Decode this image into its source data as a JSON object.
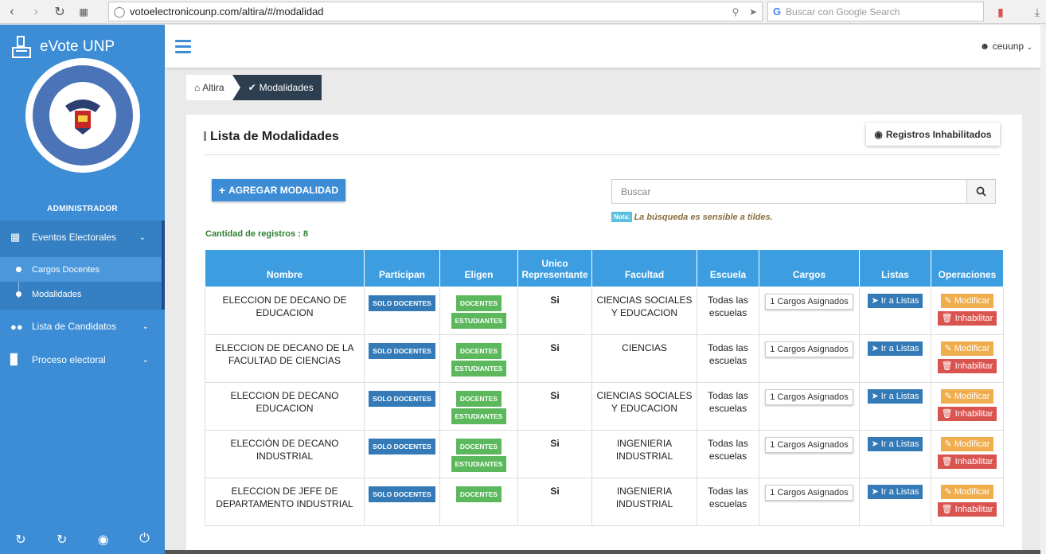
{
  "browser": {
    "url": "votoelectronicounp.com/altira/#/modalidad",
    "search_placeholder": "Buscar con Google Search"
  },
  "sidebar": {
    "brand": "eVote UNP",
    "role": "ADMINISTRADOR",
    "menu": [
      {
        "label": "Eventos Electorales",
        "icon": "calendar-icon"
      },
      {
        "label": "Lista de Candidatos",
        "icon": "users-icon"
      },
      {
        "label": "Proceso electoral",
        "icon": "chart-icon"
      }
    ],
    "submenu": [
      {
        "label": "Cargos Docentes"
      },
      {
        "label": "Modalidades"
      }
    ]
  },
  "header": {
    "user": "ceuunp"
  },
  "breadcrumb": {
    "home": "Altira",
    "current": "Modalidades"
  },
  "page": {
    "title": "Lista de Modalidades",
    "inhabilitados_label": "Registros Inhabilitados",
    "add_label": "AGREGAR MODALIDAD",
    "search_placeholder": "Buscar",
    "nota_label": "Nota:",
    "nota_text": "La búsqueda es sensible a tildes.",
    "count_text": "Cantidad de registros : 8"
  },
  "table": {
    "headers": [
      "Nombre",
      "Participan",
      "Eligen",
      "Unico Representante",
      "Facultad",
      "Escuela",
      "Cargos",
      "Listas",
      "Operaciones"
    ],
    "rows": [
      {
        "nombre": "ELECCION DE DECANO DE EDUCACION",
        "participan": "SOLO DOCENTES",
        "eligen": [
          "DOCENTES",
          "ESTUDIANTES"
        ],
        "unico": "Si",
        "facultad": "CIENCIAS SOCIALES Y EDUCACION",
        "escuela": "Todas las escuelas",
        "cargos": "1 Cargos Asignados",
        "listas": "Ir a Listas",
        "modificar": "Modificar",
        "inhabilitar": "Inhabilitar"
      },
      {
        "nombre": "ELECCION DE DECANO DE LA FACULTAD DE CIENCIAS",
        "participan": "SOLO DOCENTES",
        "eligen": [
          "DOCENTES",
          "ESTUDIANTES"
        ],
        "unico": "Si",
        "facultad": "CIENCIAS",
        "escuela": "Todas las escuelas",
        "cargos": "1 Cargos Asignados",
        "listas": "Ir a Listas",
        "modificar": "Modificar",
        "inhabilitar": "Inhabilitar"
      },
      {
        "nombre": "ELECCION DE DECANO EDUCACION",
        "participan": "SOLO DOCENTES",
        "eligen": [
          "DOCENTES",
          "ESTUDIANTES"
        ],
        "unico": "Si",
        "facultad": "CIENCIAS SOCIALES Y EDUCACION",
        "escuela": "Todas las escuelas",
        "cargos": "1 Cargos Asignados",
        "listas": "Ir a Listas",
        "modificar": "Modificar",
        "inhabilitar": "Inhabilitar"
      },
      {
        "nombre": "ELECCIÓN DE DECANO INDUSTRIAL",
        "participan": "SOLO DOCENTES",
        "eligen": [
          "DOCENTES",
          "ESTUDIANTES"
        ],
        "unico": "Si",
        "facultad": "INGENIERIA INDUSTRIAL",
        "escuela": "Todas las escuelas",
        "cargos": "1 Cargos Asignados",
        "listas": "Ir a Listas",
        "modificar": "Modificar",
        "inhabilitar": "Inhabilitar"
      },
      {
        "nombre": "ELECCION DE JEFE DE DEPARTAMENTO INDUSTRIAL",
        "participan": "SOLO DOCENTES",
        "eligen": [
          "DOCENTES"
        ],
        "unico": "Si",
        "facultad": "INGENIERIA INDUSTRIAL",
        "escuela": "Todas las escuelas",
        "cargos": "1 Cargos Asignados",
        "listas": "Ir a Listas",
        "modificar": "Modificar",
        "inhabilitar": "Inhabilitar"
      }
    ]
  },
  "colors": {
    "sidebar": "#3c8dd5",
    "header_blue": "#3c9ee0",
    "breadcrumb_dark": "#2d3e50",
    "warning": "#f0ad4e",
    "danger": "#d9534f",
    "success": "#5cb85c",
    "primary": "#337ab7"
  }
}
